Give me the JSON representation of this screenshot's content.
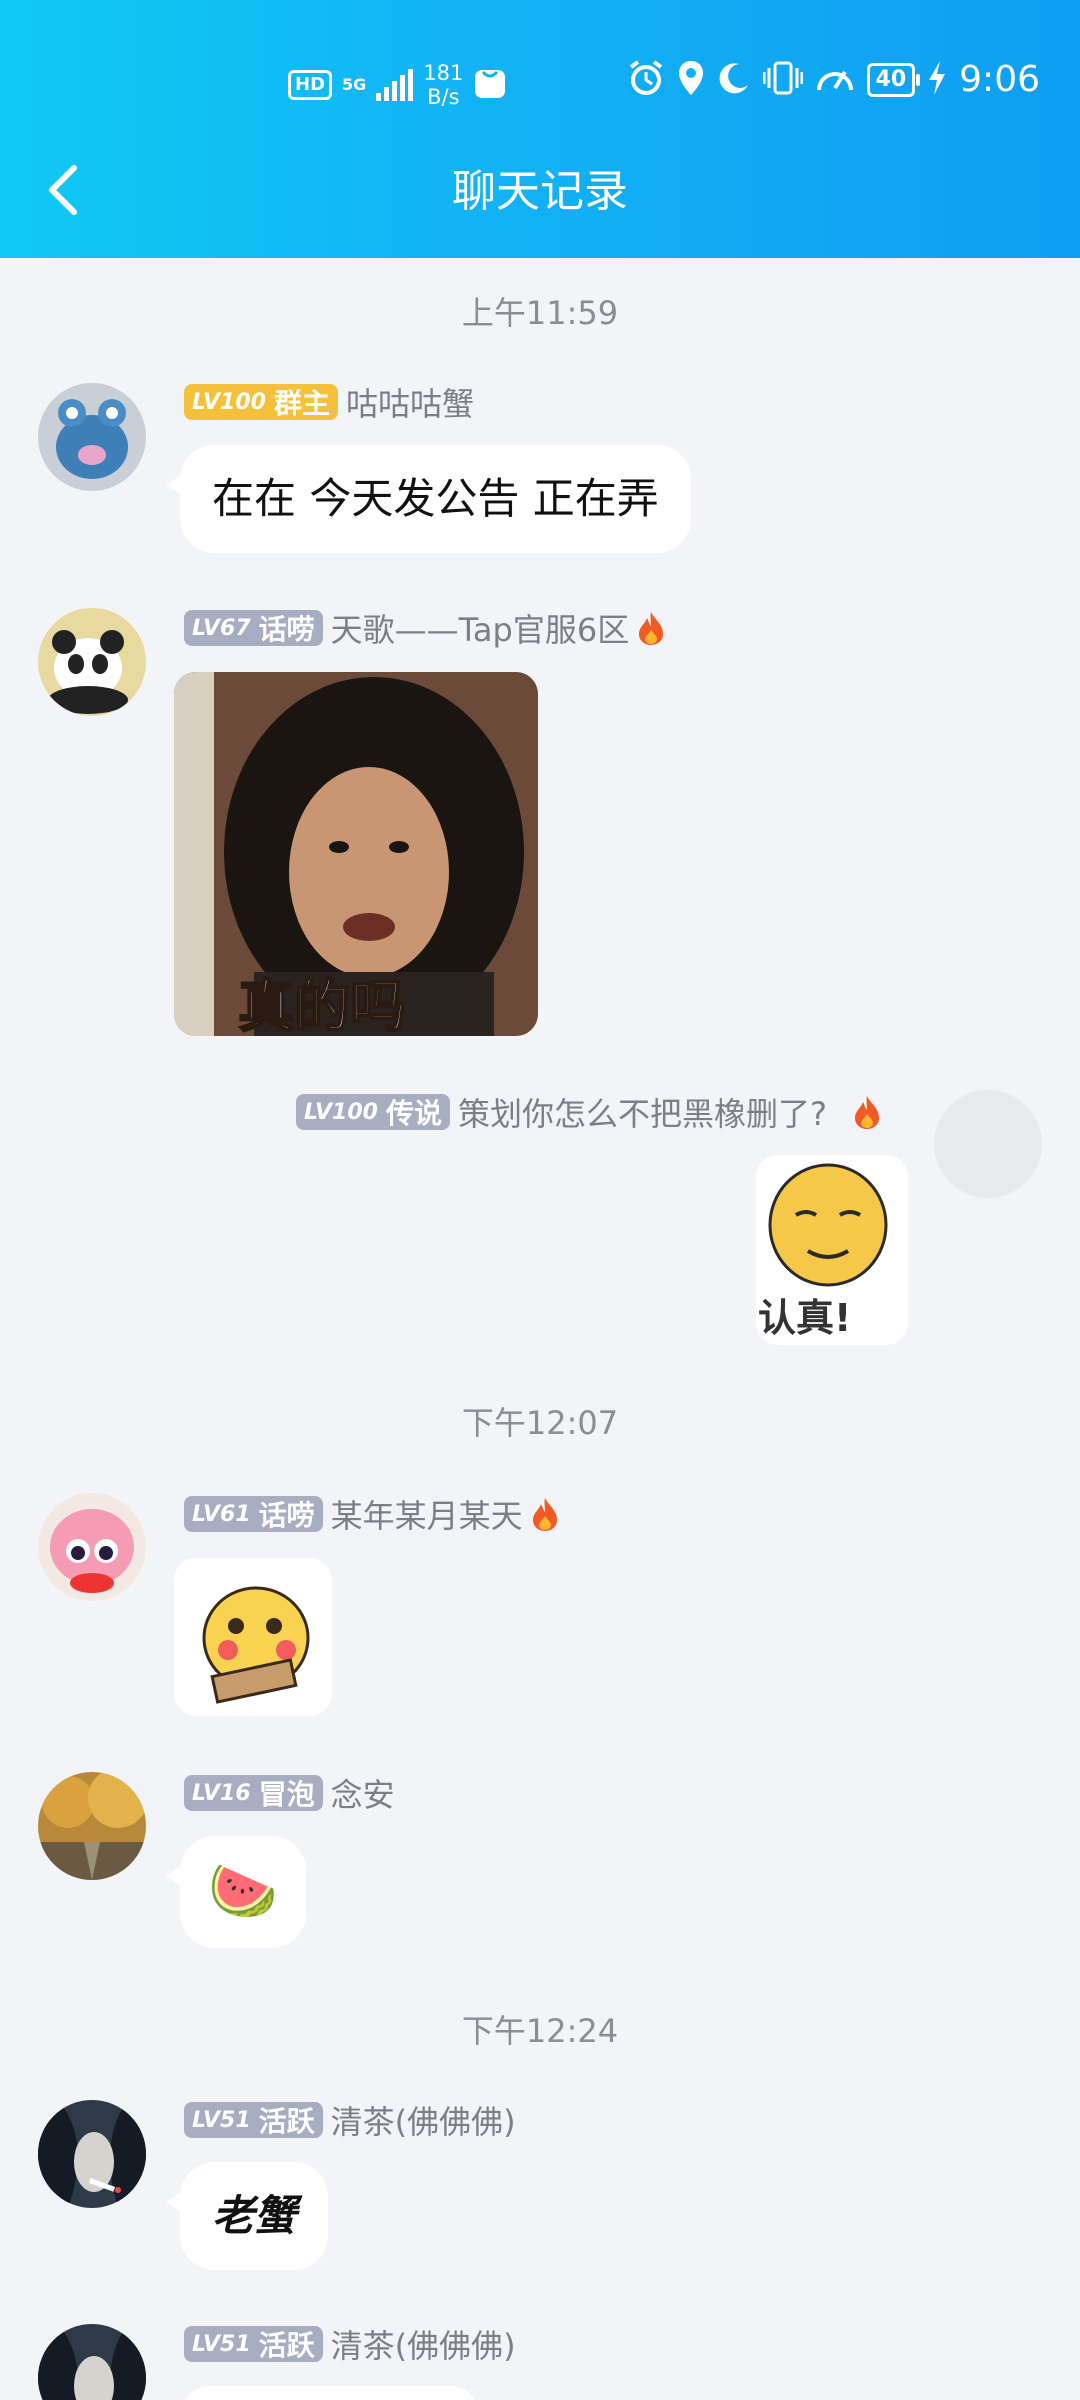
{
  "statusbar": {
    "hd": "HD",
    "net": "5G",
    "speed_value": "181",
    "speed_unit": "B/s",
    "battery": "40",
    "time": "9:06",
    "icons": [
      "alarm-icon",
      "location-icon",
      "moon-icon",
      "vibrate-icon",
      "speed-icon",
      "charging-icon"
    ]
  },
  "header": {
    "title": "聊天记录",
    "back_icon": "back-arrow-icon",
    "colors": {
      "from": "#10c9f4",
      "to": "#0f9ef2"
    }
  },
  "chat": {
    "timestamps": [
      "上午11:59",
      "下午12:07",
      "下午12:24"
    ],
    "messages": [
      {
        "level_num": "LV100",
        "level_title": "群主",
        "nickname": "咕咕咕蟹",
        "text": "在在 今天发公告 正在弄"
      },
      {
        "level_num": "LV67",
        "level_title": "话唠",
        "nickname": "天歌——Tap官服6区",
        "sticker_caption": "真的吗"
      },
      {
        "level_num": "LV100",
        "level_title": "传说",
        "nickname": "策划你怎么不把黑橡删了?",
        "sticker_caption": "认真!"
      },
      {
        "level_num": "LV61",
        "level_title": "话唠",
        "nickname": "某年某月某天"
      },
      {
        "level_num": "LV16",
        "level_title": "冒泡",
        "nickname": "念安",
        "emoji": "🍉"
      },
      {
        "level_num": "LV51",
        "level_title": "活跃",
        "nickname": "清茶(佛佛佛)",
        "text": "老蟹"
      },
      {
        "level_num": "LV51",
        "level_title": "活跃",
        "nickname": "清茶(佛佛佛)"
      }
    ]
  }
}
